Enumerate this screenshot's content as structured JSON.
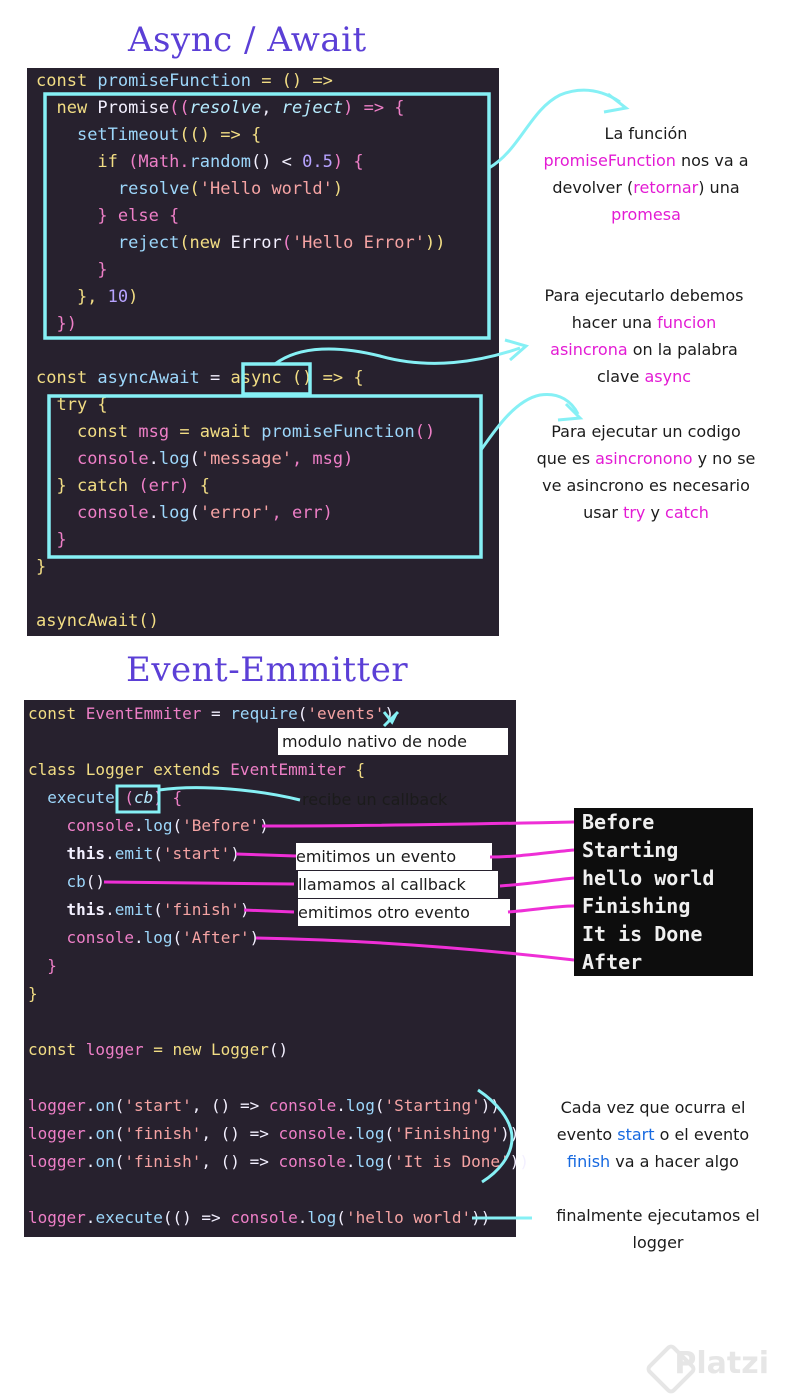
{
  "titles": {
    "async": "Async / Await",
    "event": "Event-Emmitter"
  },
  "async_code": {
    "l1": {
      "a": "const ",
      "b": "promiseFunction",
      "c": " = () =>"
    },
    "l2": {
      "a": "  new ",
      "b": "Promise",
      "c": "((",
      "d": "resolve",
      "e": ", ",
      "f": "reject",
      "g": ") => {"
    },
    "l3": {
      "a": "    ",
      "b": "setTimeout",
      "c": "(() => {"
    },
    "l4": {
      "a": "      if ",
      "b": "(Math.",
      "c": "random",
      "d": "() < ",
      "e": "0.5",
      "f": ") {"
    },
    "l5": {
      "a": "        ",
      "b": "resolve",
      "c": "(",
      "d": "'Hello world'",
      "e": ")"
    },
    "l6": {
      "a": "      } else {"
    },
    "l7": {
      "a": "        ",
      "b": "reject",
      "c": "(new ",
      "d": "Error",
      "e": "(",
      "f": "'Hello Error'",
      "g": "))"
    },
    "l8": {
      "a": "      }"
    },
    "l9": {
      "a": "    }, ",
      "b": "10",
      "c": ")"
    },
    "l10": {
      "a": "  })"
    },
    "l11": {
      "a": "const ",
      "b": "asyncAwait",
      "c": " = ",
      "d": "async",
      "e": " () => {"
    },
    "l12": {
      "a": "  try {"
    },
    "l13": {
      "a": "    const ",
      "b": "msg",
      "c": " = await ",
      "d": "promiseFunction",
      "e": "()"
    },
    "l14": {
      "a": "    ",
      "b": "console",
      "c": ".",
      "d": "log",
      "e": "(",
      "f": "'message'",
      "g": ", msg)"
    },
    "l15": {
      "a": "  } catch ",
      "b": "(err)",
      "c": " {"
    },
    "l16": {
      "a": "    ",
      "b": "console",
      "c": ".",
      "d": "log",
      "e": "(",
      "f": "'error'",
      "g": ", err)"
    },
    "l17": {
      "a": "  }"
    },
    "l18": {
      "a": "}"
    },
    "l19": {
      "a": "asyncAwait",
      "b": "()"
    }
  },
  "event_code": {
    "e1": {
      "a": "const ",
      "b": "EventEmmiter",
      "c": " = ",
      "d": "require",
      "e": "(",
      "f": "'events'",
      "g": ")"
    },
    "e2": {
      "a": "class ",
      "b": "Logger",
      "c": " extends ",
      "d": "EventEmmiter",
      "e": " {"
    },
    "e3": {
      "a": "  ",
      "b": "execute",
      "c": " (",
      "d": "cb",
      "e": ") {"
    },
    "e4": {
      "a": "    ",
      "b": "console",
      "c": ".",
      "d": "log",
      "e": "(",
      "f": "'Before'",
      "g": ")"
    },
    "e5": {
      "a": "    this",
      "b": ".",
      "c": "emit",
      "d": "(",
      "e": "'start'",
      "f": ")"
    },
    "e6": {
      "a": "    ",
      "b": "cb",
      "c": "()"
    },
    "e7": {
      "a": "    this",
      "b": ".",
      "c": "emit",
      "d": "(",
      "e": "'finish'",
      "f": ")"
    },
    "e8": {
      "a": "    ",
      "b": "console",
      "c": ".",
      "d": "log",
      "e": "(",
      "f": "'After'",
      "g": ")"
    },
    "e9": {
      "a": "  }"
    },
    "e10": {
      "a": "}"
    },
    "e11": {
      "a": "const ",
      "b": "logger",
      "c": " = new ",
      "d": "Logger",
      "e": "()"
    },
    "e12": {
      "a": "logger",
      "b": ".",
      "c": "on",
      "d": "(",
      "e": "'start'",
      "f": ", () => ",
      "g": "console",
      "h": ".",
      "i": "log",
      "j": "(",
      "k": "'Starting'",
      "l": "))"
    },
    "e13": {
      "a": "logger",
      "b": ".",
      "c": "on",
      "d": "(",
      "e": "'finish'",
      "f": ", () => ",
      "g": "console",
      "h": ".",
      "i": "log",
      "j": "(",
      "k": "'Finishing'",
      "l": "))"
    },
    "e14": {
      "a": "logger",
      "b": ".",
      "c": "on",
      "d": "(",
      "e": "'finish'",
      "f": ", () => ",
      "g": "console",
      "h": ".",
      "i": "log",
      "j": "(",
      "k": "'It is Done'",
      "l": "))"
    },
    "e15": {
      "a": "logger",
      "b": ".",
      "c": "execute",
      "d": "(() => ",
      "e": "console",
      "f": ".",
      "g": "log",
      "h": "(",
      "i": "'hello world'",
      "j": "))"
    }
  },
  "annotations": {
    "a1": {
      "l1": "La función",
      "l2a": "promiseFunction",
      "l2b": " nos va a",
      "l3a": "devolver (",
      "l3b": "retornar",
      "l3c": ") una",
      "l4": "promesa"
    },
    "a2": {
      "l1": "Para ejecutarlo debemos",
      "l2a": "hacer una ",
      "l2b": "funcion",
      "l3a": "asincrona",
      "l3b": " on la palabra",
      "l4a": "clave ",
      "l4b": "async"
    },
    "a3": {
      "l1": "Para ejecutar un codigo",
      "l2a": "que es ",
      "l2b": "asincronono",
      "l2c": " y no se",
      "l3": "ve asincrono es necesario",
      "l4a": "usar ",
      "l4b": "try",
      "l4c": " y ",
      "l4d": "catch"
    },
    "b1": "modulo nativo de node",
    "b2": "recibe un callback",
    "b3": "emitimos un evento",
    "b4": "llamamos al callback",
    "b5": "emitimos otro evento",
    "b6": {
      "l1": "Cada vez que ocurra el",
      "l2a": "evento ",
      "l2b": "start",
      "l2c": " o el evento",
      "l3a": "finish",
      "l3b": " va a hacer algo"
    },
    "b7": {
      "l1": "finalmente ejecutamos el",
      "l2": "logger"
    }
  },
  "terminal": {
    "lines": [
      "Before",
      "Starting",
      "hello world",
      "Finishing",
      "It is Done",
      "After"
    ]
  },
  "watermark": "Platzi",
  "colors": {
    "title": "#5b3fd6",
    "highlight_box": "#86f0f5",
    "arrow_pink": "#ee2fd6",
    "accent_magenta": "#e31bd4",
    "accent_blue": "#1769e0"
  }
}
